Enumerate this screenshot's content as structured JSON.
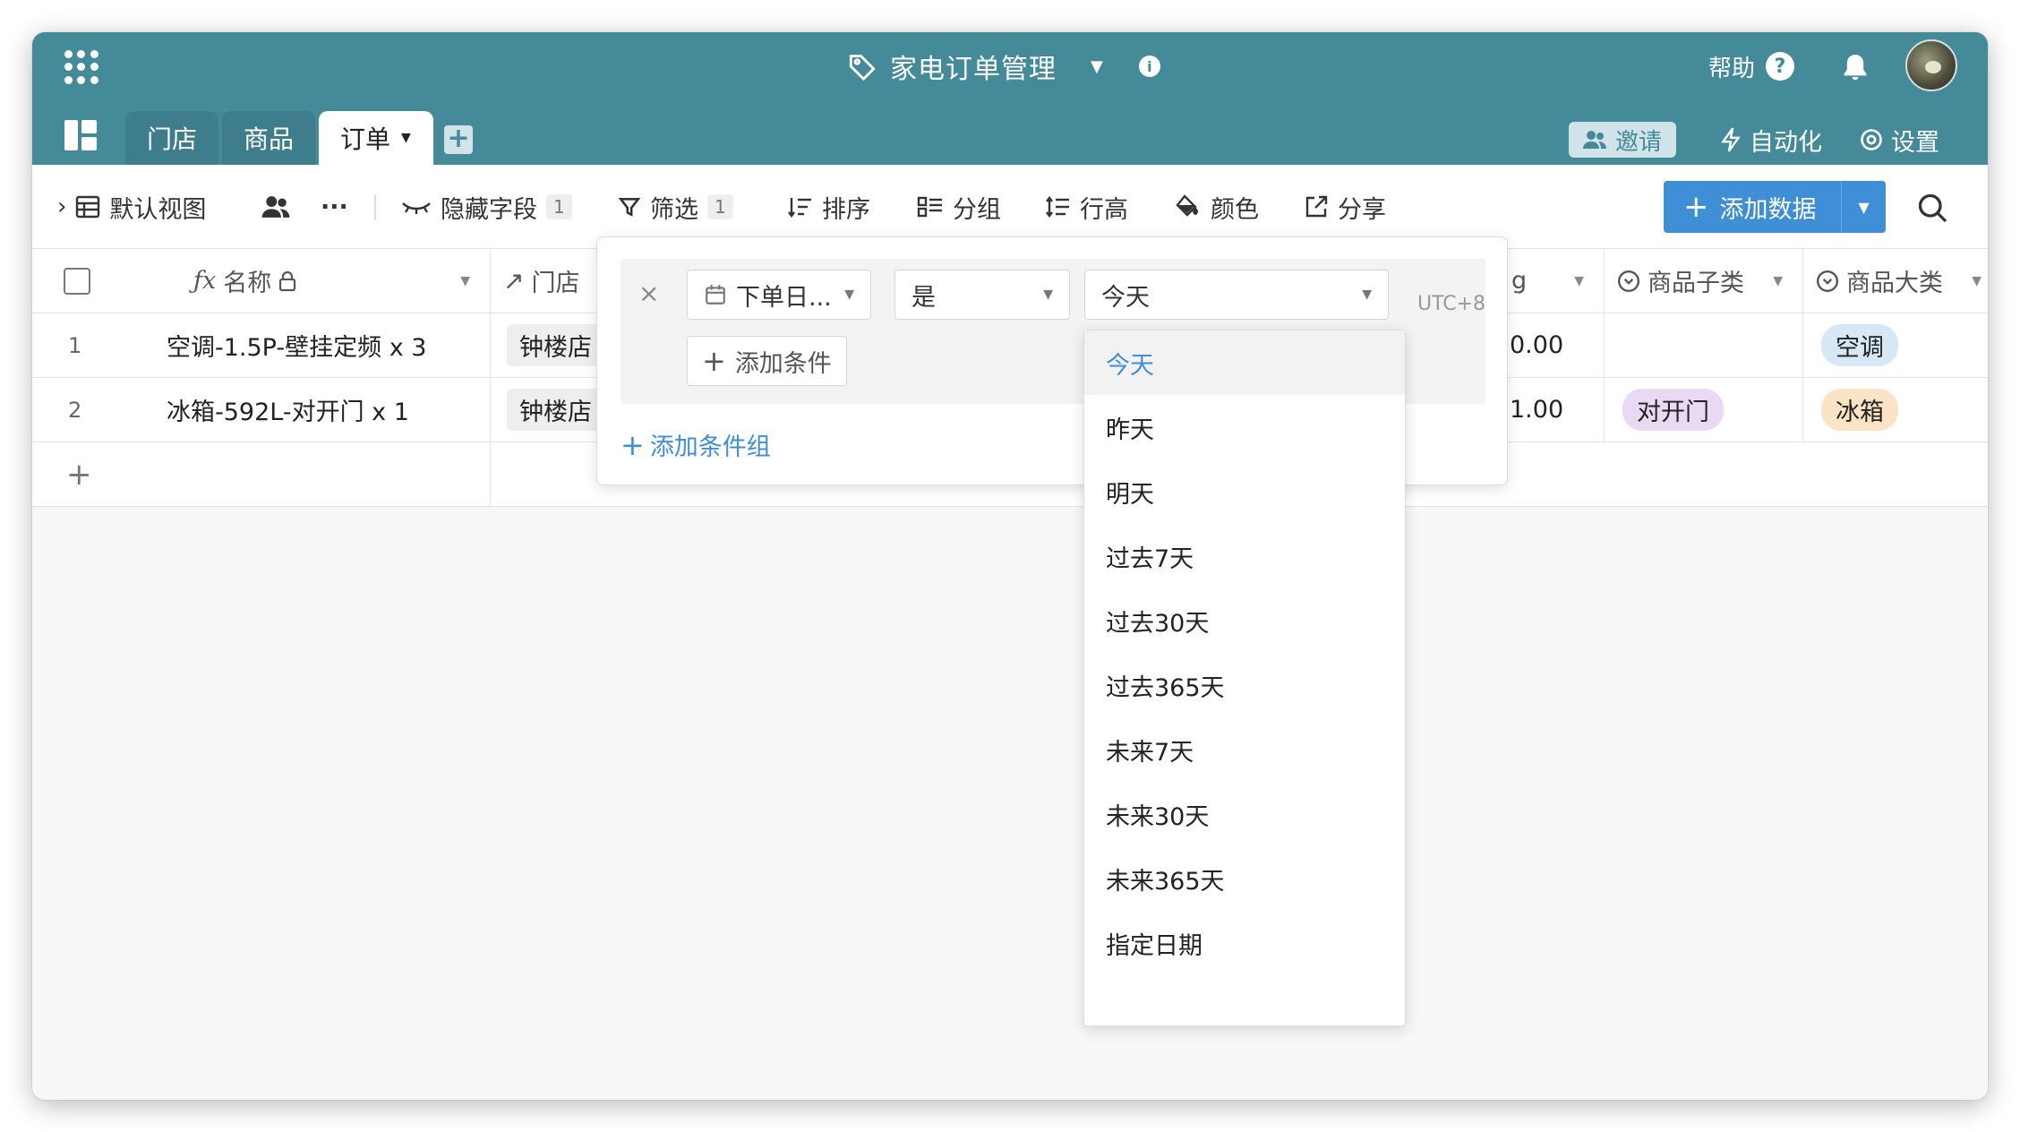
{
  "app": {
    "title": "家电订单管理",
    "help_label": "帮助"
  },
  "tabs": [
    {
      "label": "门店"
    },
    {
      "label": "商品"
    },
    {
      "label": "订单"
    }
  ],
  "top_actions": {
    "invite": "邀请",
    "automation": "自动化",
    "settings": "设置"
  },
  "toolbar": {
    "view_name": "默认视图",
    "more": "···",
    "hide_fields": "隐藏字段",
    "hide_fields_count": "1",
    "filter": "筛选",
    "filter_count": "1",
    "sort": "排序",
    "group": "分组",
    "row_height": "行高",
    "color": "颜色",
    "share": "分享",
    "add_data": "添加数据"
  },
  "columns": {
    "name": "名称",
    "store": "门店",
    "partial": "g",
    "subcategory": "商品子类",
    "category": "商品大类"
  },
  "rows": [
    {
      "num": "1",
      "name": "空调-1.5P-壁挂定频 x 3",
      "store": "钟楼店",
      "amount": "0.00",
      "subcategory": "",
      "category": "空调"
    },
    {
      "num": "2",
      "name": "冰箱-592L-对开门 x 1",
      "store": "钟楼店",
      "amount": "1.00",
      "subcategory": "对开门",
      "category": "冰箱"
    }
  ],
  "add_row": "+",
  "filter_panel": {
    "field": "下单日...",
    "operator": "是",
    "value": "今天",
    "timezone": "UTC+8",
    "add_condition": "添加条件",
    "add_condition_group": "添加条件组"
  },
  "date_options": [
    "今天",
    "昨天",
    "明天",
    "过去7天",
    "过去30天",
    "过去365天",
    "未来7天",
    "未来30天",
    "未来365天",
    "指定日期"
  ],
  "colors": {
    "topbar": "#448a99",
    "accent": "#3e8fd6",
    "tag_aircon": "#d6e8f5",
    "tag_fridge": "#fbe3c6",
    "tag_door": "#ead9f2"
  }
}
